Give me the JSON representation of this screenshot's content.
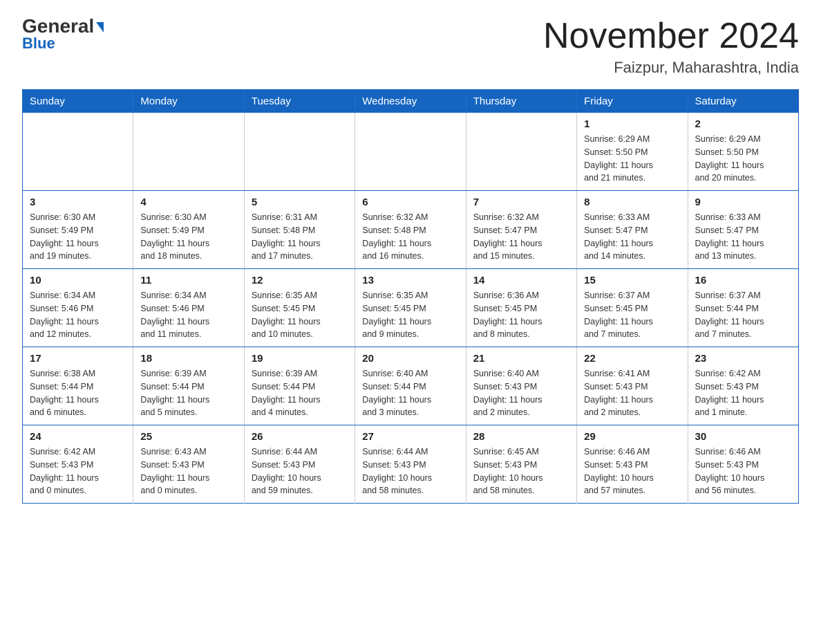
{
  "logo": {
    "general": "General",
    "blue": "Blue",
    "triangle_color": "#1565c0"
  },
  "header": {
    "month": "November 2024",
    "location": "Faizpur, Maharashtra, India"
  },
  "weekdays": [
    "Sunday",
    "Monday",
    "Tuesday",
    "Wednesday",
    "Thursday",
    "Friday",
    "Saturday"
  ],
  "weeks": [
    [
      {
        "day": "",
        "info": ""
      },
      {
        "day": "",
        "info": ""
      },
      {
        "day": "",
        "info": ""
      },
      {
        "day": "",
        "info": ""
      },
      {
        "day": "",
        "info": ""
      },
      {
        "day": "1",
        "info": "Sunrise: 6:29 AM\nSunset: 5:50 PM\nDaylight: 11 hours\nand 21 minutes."
      },
      {
        "day": "2",
        "info": "Sunrise: 6:29 AM\nSunset: 5:50 PM\nDaylight: 11 hours\nand 20 minutes."
      }
    ],
    [
      {
        "day": "3",
        "info": "Sunrise: 6:30 AM\nSunset: 5:49 PM\nDaylight: 11 hours\nand 19 minutes."
      },
      {
        "day": "4",
        "info": "Sunrise: 6:30 AM\nSunset: 5:49 PM\nDaylight: 11 hours\nand 18 minutes."
      },
      {
        "day": "5",
        "info": "Sunrise: 6:31 AM\nSunset: 5:48 PM\nDaylight: 11 hours\nand 17 minutes."
      },
      {
        "day": "6",
        "info": "Sunrise: 6:32 AM\nSunset: 5:48 PM\nDaylight: 11 hours\nand 16 minutes."
      },
      {
        "day": "7",
        "info": "Sunrise: 6:32 AM\nSunset: 5:47 PM\nDaylight: 11 hours\nand 15 minutes."
      },
      {
        "day": "8",
        "info": "Sunrise: 6:33 AM\nSunset: 5:47 PM\nDaylight: 11 hours\nand 14 minutes."
      },
      {
        "day": "9",
        "info": "Sunrise: 6:33 AM\nSunset: 5:47 PM\nDaylight: 11 hours\nand 13 minutes."
      }
    ],
    [
      {
        "day": "10",
        "info": "Sunrise: 6:34 AM\nSunset: 5:46 PM\nDaylight: 11 hours\nand 12 minutes."
      },
      {
        "day": "11",
        "info": "Sunrise: 6:34 AM\nSunset: 5:46 PM\nDaylight: 11 hours\nand 11 minutes."
      },
      {
        "day": "12",
        "info": "Sunrise: 6:35 AM\nSunset: 5:45 PM\nDaylight: 11 hours\nand 10 minutes."
      },
      {
        "day": "13",
        "info": "Sunrise: 6:35 AM\nSunset: 5:45 PM\nDaylight: 11 hours\nand 9 minutes."
      },
      {
        "day": "14",
        "info": "Sunrise: 6:36 AM\nSunset: 5:45 PM\nDaylight: 11 hours\nand 8 minutes."
      },
      {
        "day": "15",
        "info": "Sunrise: 6:37 AM\nSunset: 5:45 PM\nDaylight: 11 hours\nand 7 minutes."
      },
      {
        "day": "16",
        "info": "Sunrise: 6:37 AM\nSunset: 5:44 PM\nDaylight: 11 hours\nand 7 minutes."
      }
    ],
    [
      {
        "day": "17",
        "info": "Sunrise: 6:38 AM\nSunset: 5:44 PM\nDaylight: 11 hours\nand 6 minutes."
      },
      {
        "day": "18",
        "info": "Sunrise: 6:39 AM\nSunset: 5:44 PM\nDaylight: 11 hours\nand 5 minutes."
      },
      {
        "day": "19",
        "info": "Sunrise: 6:39 AM\nSunset: 5:44 PM\nDaylight: 11 hours\nand 4 minutes."
      },
      {
        "day": "20",
        "info": "Sunrise: 6:40 AM\nSunset: 5:44 PM\nDaylight: 11 hours\nand 3 minutes."
      },
      {
        "day": "21",
        "info": "Sunrise: 6:40 AM\nSunset: 5:43 PM\nDaylight: 11 hours\nand 2 minutes."
      },
      {
        "day": "22",
        "info": "Sunrise: 6:41 AM\nSunset: 5:43 PM\nDaylight: 11 hours\nand 2 minutes."
      },
      {
        "day": "23",
        "info": "Sunrise: 6:42 AM\nSunset: 5:43 PM\nDaylight: 11 hours\nand 1 minute."
      }
    ],
    [
      {
        "day": "24",
        "info": "Sunrise: 6:42 AM\nSunset: 5:43 PM\nDaylight: 11 hours\nand 0 minutes."
      },
      {
        "day": "25",
        "info": "Sunrise: 6:43 AM\nSunset: 5:43 PM\nDaylight: 11 hours\nand 0 minutes."
      },
      {
        "day": "26",
        "info": "Sunrise: 6:44 AM\nSunset: 5:43 PM\nDaylight: 10 hours\nand 59 minutes."
      },
      {
        "day": "27",
        "info": "Sunrise: 6:44 AM\nSunset: 5:43 PM\nDaylight: 10 hours\nand 58 minutes."
      },
      {
        "day": "28",
        "info": "Sunrise: 6:45 AM\nSunset: 5:43 PM\nDaylight: 10 hours\nand 58 minutes."
      },
      {
        "day": "29",
        "info": "Sunrise: 6:46 AM\nSunset: 5:43 PM\nDaylight: 10 hours\nand 57 minutes."
      },
      {
        "day": "30",
        "info": "Sunrise: 6:46 AM\nSunset: 5:43 PM\nDaylight: 10 hours\nand 56 minutes."
      }
    ]
  ]
}
